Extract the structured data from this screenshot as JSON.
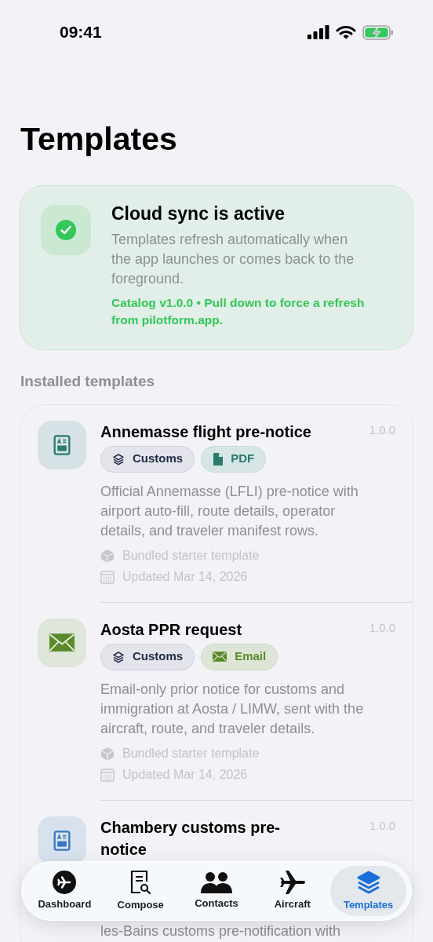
{
  "status_bar": {
    "time": "09:41"
  },
  "title": "Templates",
  "sync_card": {
    "title": "Cloud sync is active",
    "body": "Templates refresh automatically when the app launches or comes back to the foreground.",
    "note": "Catalog v1.0.0 • Pull down to force a refresh from pilotform.app."
  },
  "section_label": "Installed templates",
  "templates": [
    {
      "kind": "form",
      "color": "#2b7a6e",
      "title": "Annemasse flight pre-notice",
      "version": "1.0.0",
      "chips": [
        {
          "kind": "layers",
          "label": "Customs",
          "color": "#1e2a44"
        },
        {
          "kind": "file",
          "label": "PDF",
          "color": "#2b7a6e"
        }
      ],
      "description": "Official Annemasse (LFLI) pre-notice with airport auto-fill, route details, operator details, and traveler manifest rows.",
      "source": "Bundled starter template",
      "updated": "Updated Mar 14, 2026"
    },
    {
      "kind": "mail",
      "color": "#5a8a2a",
      "title": "Aosta PPR request",
      "version": "1.0.0",
      "chips": [
        {
          "kind": "layers",
          "label": "Customs",
          "color": "#1e2a44"
        },
        {
          "kind": "mail",
          "label": "Email",
          "color": "#5a8a2a"
        }
      ],
      "description": "Email-only prior notice for customs and immigration at Aosta / LIMW, sent with the aircraft, route, and traveler details.",
      "source": "Bundled starter template",
      "updated": "Updated Mar 14, 2026"
    },
    {
      "kind": "form",
      "color": "#3a78c0",
      "title": "Chambery customs pre-notice",
      "version": "1.0.0",
      "description": "les-Bains customs pre-notification with"
    }
  ],
  "tab_bar": [
    {
      "kind": "dashboard",
      "label": "Dashboard",
      "selected": false
    },
    {
      "kind": "compose",
      "label": "Compose",
      "selected": false
    },
    {
      "kind": "contacts",
      "label": "Contacts",
      "selected": false
    },
    {
      "kind": "aircraft",
      "label": "Aircraft",
      "selected": false
    },
    {
      "kind": "templates",
      "label": "Templates",
      "selected": true
    }
  ]
}
